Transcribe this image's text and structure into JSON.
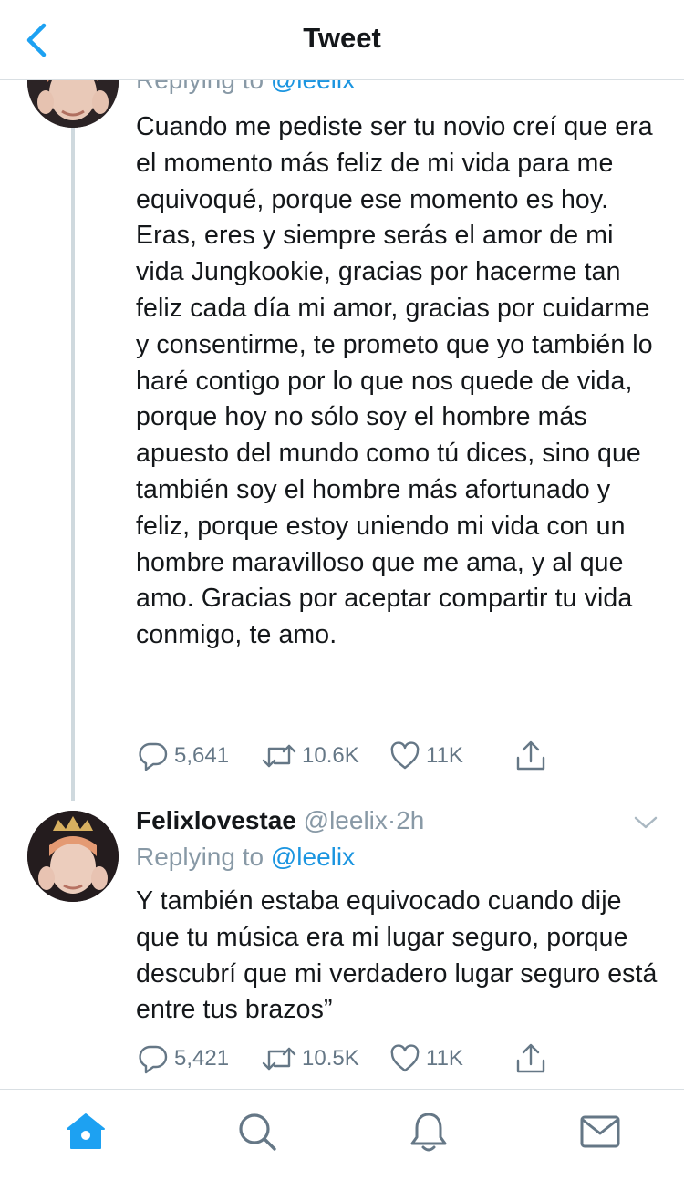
{
  "header": {
    "title": "Tweet"
  },
  "tweet1": {
    "replying_prefix": "Replying to",
    "replying_handle": "@leelix",
    "paragraphs": [
      "Cuando me pediste ser tu novio creí que era el momento más feliz de mi vida para me equivoqué, porque ese momento es hoy.",
      "Eras, eres y siempre serás el amor de mi vida Jungkookie, gracias por hacerme tan feliz cada día mi amor, gracias por cuidarme y consentirme, te prometo que yo también lo haré contigo por lo que nos quede de vida, porque hoy no sólo soy el hombre más apuesto del mundo como tú dices, sino que también soy el hombre más afortunado y feliz, porque estoy uniendo mi vida con un hombre maravilloso que me ama, y al que amo. Gracias por aceptar compartir tu vida conmigo, te amo."
    ],
    "replies": "5,641",
    "retweets": "10.6K",
    "likes": "11K"
  },
  "tweet2": {
    "name": "Felixlovestae",
    "handle": "@leelix",
    "separator": "·",
    "time": "2h",
    "replying_prefix": "Replying to",
    "replying_handle": "@leelix",
    "text": "Y también estaba equivocado cuando dije que tu música era mi lugar seguro, porque descubrí que mi verdadero lugar seguro está entre tus brazos”",
    "replies": "5,421",
    "retweets": "10.5K",
    "likes": "11K"
  },
  "icons": {
    "back": "chevron-left-icon",
    "reply": "reply-bubble-icon",
    "retweet": "retweet-icon",
    "like": "heart-icon",
    "share": "share-icon",
    "caret": "chevron-down-icon",
    "home": "home-icon",
    "search": "search-icon",
    "notifications": "bell-icon",
    "messages": "envelope-icon"
  },
  "colors": {
    "accent": "#1da1f2",
    "text": "#14171a",
    "secondary": "#657786"
  }
}
